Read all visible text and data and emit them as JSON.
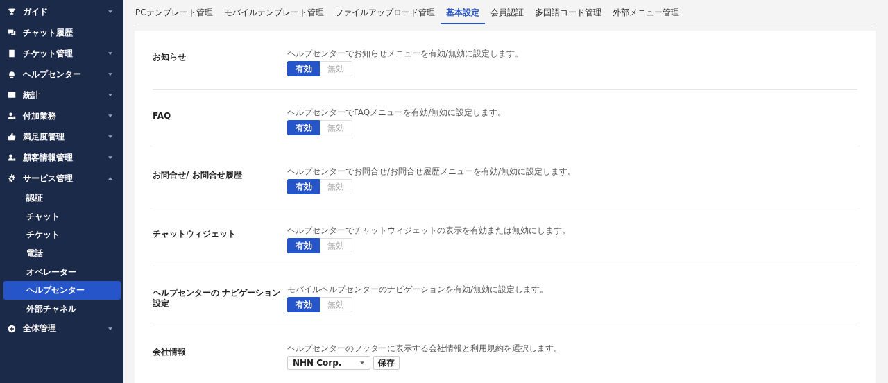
{
  "sidebar": {
    "items": [
      {
        "label": "ガイド",
        "kind": "group",
        "expanded": false
      },
      {
        "label": "チャット履歴",
        "kind": "link"
      },
      {
        "label": "チケット管理",
        "kind": "group",
        "expanded": false
      },
      {
        "label": "ヘルプセンター",
        "kind": "group",
        "expanded": false
      },
      {
        "label": "統計",
        "kind": "group",
        "expanded": false
      },
      {
        "label": "付加業務",
        "kind": "group",
        "expanded": false
      },
      {
        "label": "満足度管理",
        "kind": "group",
        "expanded": false
      },
      {
        "label": "顧客情報管理",
        "kind": "group",
        "expanded": false
      },
      {
        "label": "サービス管理",
        "kind": "group",
        "expanded": true,
        "children": [
          {
            "label": "認証",
            "selected": false
          },
          {
            "label": "チャット",
            "selected": false
          },
          {
            "label": "チケット",
            "selected": false
          },
          {
            "label": "電話",
            "selected": false
          },
          {
            "label": "オペレーター",
            "selected": false
          },
          {
            "label": "ヘルプセンター",
            "selected": true
          },
          {
            "label": "外部チャネル",
            "selected": false
          }
        ]
      },
      {
        "label": "全体管理",
        "kind": "group",
        "expanded": false
      }
    ]
  },
  "tabs": [
    {
      "label": "PCテンプレート管理",
      "selected": false
    },
    {
      "label": "モバイルテンプレート管理",
      "selected": false
    },
    {
      "label": "ファイルアップロード管理",
      "selected": false
    },
    {
      "label": "基本設定",
      "selected": true
    },
    {
      "label": "会員認証",
      "selected": false
    },
    {
      "label": "多国語コード管理",
      "selected": false
    },
    {
      "label": "外部メニュー管理",
      "selected": false
    }
  ],
  "settings": [
    {
      "kind": "toggle",
      "title": "お知らせ",
      "description": "ヘルプセンターでお知らせメニューを有効/無効に設定します。",
      "options": [
        {
          "label": "有効",
          "selected": true
        },
        {
          "label": "無効",
          "selected": false
        }
      ]
    },
    {
      "kind": "toggle",
      "title": "FAQ",
      "description": "ヘルプセンターでFAQメニューを有効/無効に設定します。",
      "options": [
        {
          "label": "有効",
          "selected": true
        },
        {
          "label": "無効",
          "selected": false
        }
      ]
    },
    {
      "kind": "toggle",
      "title": "お問合せ/ お問合せ履歴",
      "description": "ヘルプセンターでお問合せ/お問合せ履歴メニューを有効/無効に設定します。",
      "options": [
        {
          "label": "有効",
          "selected": true
        },
        {
          "label": "無効",
          "selected": false
        }
      ]
    },
    {
      "kind": "toggle",
      "title": "チャットウィジェット",
      "description": "ヘルプセンターでチャットウィジェットの表示を有効または無効にします。",
      "options": [
        {
          "label": "有効",
          "selected": true
        },
        {
          "label": "無効",
          "selected": false
        }
      ]
    },
    {
      "kind": "toggle",
      "title": "ヘルプセンターの ナビゲーション設定",
      "description": "モバイルヘルプセンターのナビゲーションを有効/無効に設定します。",
      "options": [
        {
          "label": "有効",
          "selected": true
        },
        {
          "label": "無効",
          "selected": false
        }
      ]
    },
    {
      "kind": "select",
      "title": "会社情報",
      "description": "ヘルプセンターのフッターに表示する会社情報と利用規約を選択します。",
      "value": "NHN Corp.",
      "button": "保存"
    }
  ]
}
